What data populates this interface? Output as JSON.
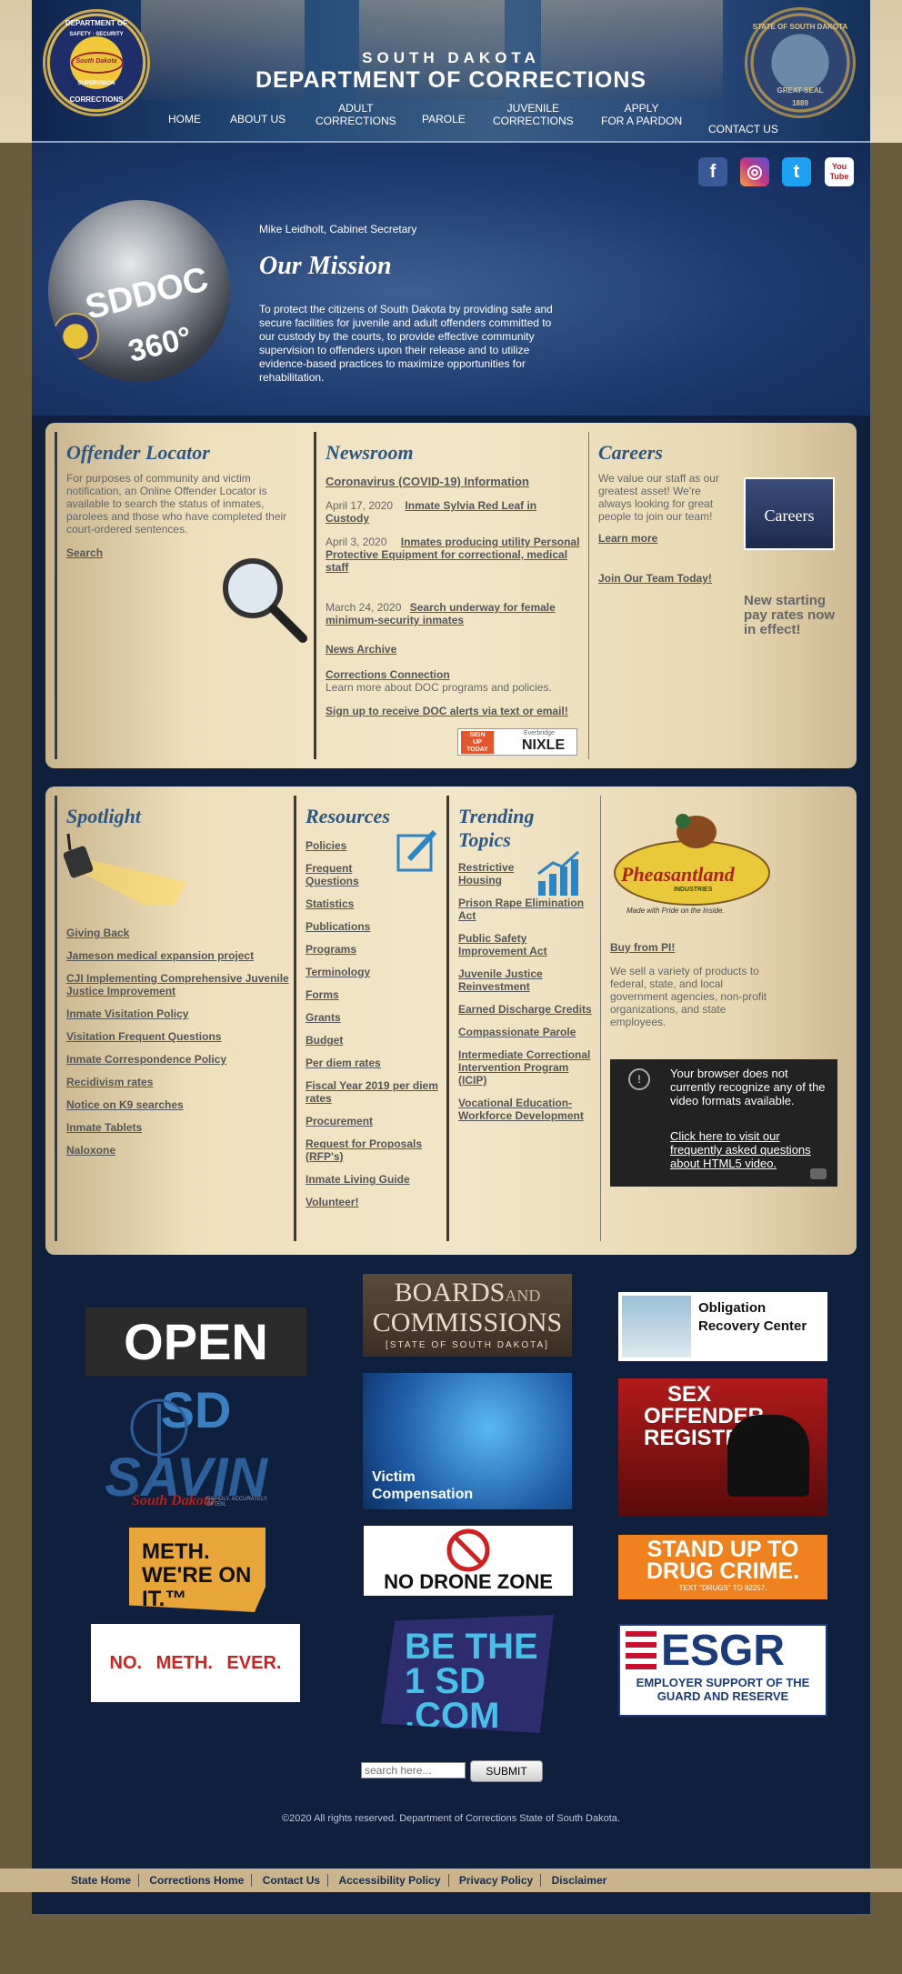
{
  "header": {
    "seal_left_text": [
      "DEPARTMENT OF",
      "SAFETY · SECURITY",
      "South Dakota",
      "SUPERVISION",
      "CORRECTIONS"
    ],
    "seal_right_text": [
      "STATE OF SOUTH DAKOTA",
      "GREAT SEAL",
      "1889"
    ],
    "brand_line1": "SOUTH DAKOTA",
    "brand_line2": "DEPARTMENT OF CORRECTIONS",
    "nav": [
      {
        "label": "HOME"
      },
      {
        "label": "ABOUT US"
      },
      {
        "label": "ADULT\nCORRECTIONS"
      },
      {
        "label": "PAROLE"
      },
      {
        "label": "JUVENILE\nCORRECTIONS"
      },
      {
        "label": "APPLY\nFOR A PARDON"
      },
      {
        "label": "CONTACT US"
      }
    ]
  },
  "hero": {
    "social": [
      {
        "name": "facebook",
        "glyph": "f",
        "color": "#3b5998"
      },
      {
        "name": "instagram",
        "glyph": "◎",
        "color": "#c13584"
      },
      {
        "name": "twitter",
        "glyph": "t",
        "color": "#1da1f2"
      },
      {
        "name": "youtube",
        "glyph": "You\nTube",
        "color": "#cc181e"
      }
    ],
    "sphere_line1": "SDDOC",
    "sphere_line2": "360°",
    "secretary": "Mike Leidholt, Cabinet Secretary",
    "mission_heading": "Our Mission",
    "mission_text": "To protect the citizens of South Dakota by providing safe and secure facilities for juvenile and adult offenders committed to our custody by the courts, to provide effective community supervision to offenders upon their release and to utilize evidence-based practices to maximize opportunities for rehabilitation."
  },
  "locator": {
    "heading": "Offender Locator",
    "text": "For purposes of community and victim notification, an Online Offender Locator is available to search the status of inmates, parolees and those who have completed their court-ordered sentences.",
    "search_link": "Search"
  },
  "newsroom": {
    "heading": "Newsroom",
    "covid_link": "Coronavirus (COVID-19) Information",
    "items": [
      {
        "date": "April 17, 2020",
        "title": "Inmate Sylvia Red Leaf in Custody"
      },
      {
        "date": "April 3, 2020",
        "title": "Inmates producing utility Personal Protective Equipment for correctional, medical staff"
      },
      {
        "date": "March 24, 2020",
        "title": "Search underway for female minimum-security inmates"
      }
    ],
    "archive_link": "News Archive",
    "connection_link": "Corrections Connection",
    "connection_text": "Learn more about DOC programs and policies.",
    "alerts_link": "Sign up to receive DOC alerts via text or email!",
    "nixle_badge": [
      "SIGN",
      "UP",
      "TODAY"
    ],
    "nixle_small": "Everbridge",
    "nixle": "NIXLE"
  },
  "careers": {
    "heading": "Careers",
    "text": "We value our staff as our greatest asset! We're always looking for great people to join our team!",
    "learn_more": "Learn more",
    "join_link": "Join Our Team Today!",
    "image_text": "Careers",
    "pay_text": "New starting pay rates now in effect!"
  },
  "spotlight": {
    "heading": "Spotlight",
    "links": [
      "Giving Back",
      "Jameson medical expansion project",
      "CJI Implementing Comprehensive Juvenile Justice Improvement",
      "Inmate Visitation Policy",
      "Visitation Frequent Questions",
      "Inmate Correspondence Policy",
      "Recidivism rates",
      "Notice on K9 searches",
      "Inmate Tablets",
      "Naloxone"
    ]
  },
  "resources": {
    "heading": "Resources",
    "links": [
      "Policies",
      "Frequent Questions",
      "Statistics",
      "Publications",
      "Programs",
      "Terminology",
      "Forms",
      "Grants",
      "Budget",
      "Per diem rates",
      "Fiscal Year 2019 per diem rates",
      "Procurement",
      "Request for Proposals (RFP's)",
      "Inmate Living Guide",
      "Volunteer!"
    ]
  },
  "trending": {
    "heading": "Trending Topics",
    "links": [
      "Restrictive Housing",
      "Prison Rape Elimination Act",
      "Public Safety Improvement Act",
      "Juvenile Justice Reinvestment",
      "Earned Discharge Credits",
      "Compassionate Parole",
      "Intermediate Correctional Intervention Program (ICIP)",
      "Vocational Education-Workforce Development"
    ]
  },
  "pheasantland": {
    "logo_text": "Pheasantland",
    "logo_sub": "INDUSTRIES",
    "tagline": "Made with Pride on the Inside.",
    "buy_link": "Buy from PI!",
    "text": "We sell a variety of products to federal, state, and local government agencies, non-profit organizations, and state employees.",
    "video_msg": "Your browser does not currently recognize any of the video formats available.",
    "video_link": "Click here to visit our frequently asked questions about HTML5 video."
  },
  "logos": {
    "open_sd": [
      "OPEN",
      "SD"
    ],
    "boards": [
      "BOARDS",
      "AND",
      "COMMISSIONS",
      "[STATE OF SOUTH DAKOTA]"
    ],
    "orc": "Obligation Recovery Center",
    "savin": "SAVIN",
    "savin_script": "South Dakota",
    "savin_tag": "RAPIDLY. ACCURATELY. OFTEN.",
    "victim": "Victim Compensation",
    "sex_offender": "SEX OFFENDER REGISTRY",
    "meth": "METH. WE'RE ON IT.™",
    "drone": "NO DRONE ZONE",
    "drug": "STAND UP TO DRUG CRIME.",
    "drug_sub": "TEXT \"DRUGS\" TO 82257.",
    "no_meth": "NO.  METH.  EVER.",
    "be1": "BE THE 1 SD .COM",
    "esgr": "ESGR",
    "esgr_sub": "EMPLOYER SUPPORT OF THE GUARD AND RESERVE"
  },
  "search": {
    "placeholder": "search here...",
    "submit": "SUBMIT"
  },
  "copyright": "©2020 All rights reserved. Department of Corrections State of South Dakota.",
  "footer_links": [
    "State Home",
    "Corrections Home",
    "Contact Us",
    "Accessibility Policy",
    "Privacy Policy",
    "Disclaimer"
  ]
}
